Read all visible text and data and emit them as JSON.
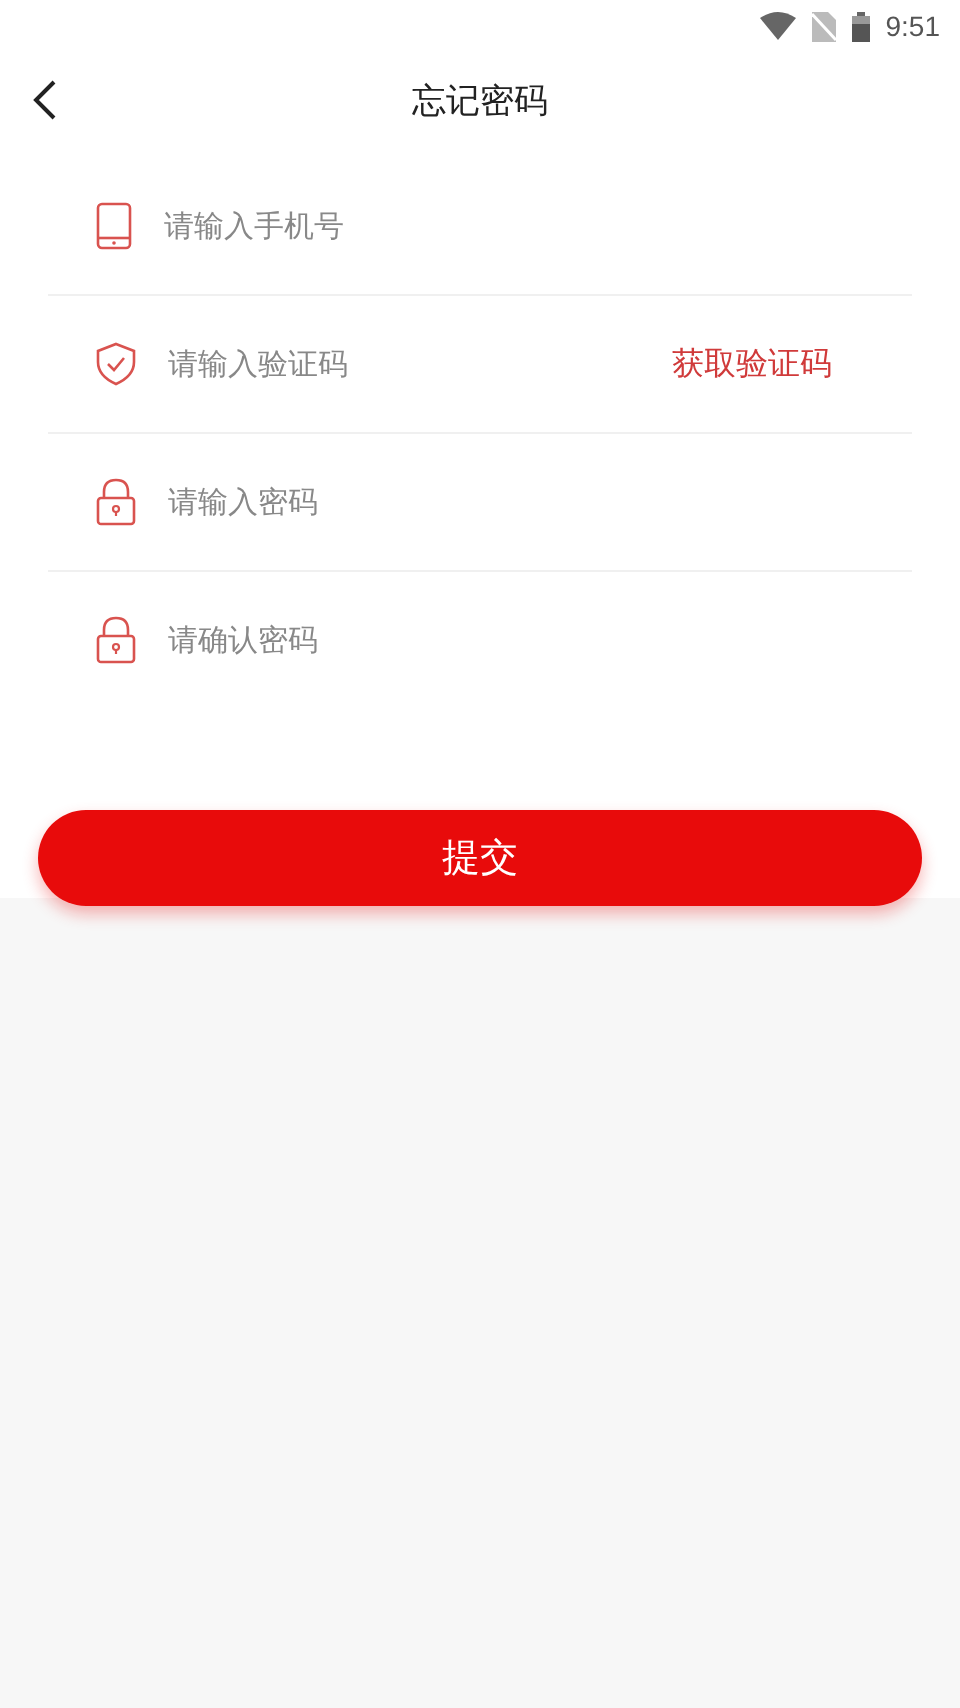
{
  "status_bar": {
    "time": "9:51"
  },
  "header": {
    "title": "忘记密码"
  },
  "fields": [
    {
      "kind": "phone",
      "placeholder": "请输入手机号"
    },
    {
      "kind": "shield",
      "placeholder": "请输入验证码",
      "action": "获取验证码"
    },
    {
      "kind": "lock",
      "placeholder": "请输入密码"
    },
    {
      "kind": "lock",
      "placeholder": "请确认密码"
    }
  ],
  "submit_button": "提交"
}
